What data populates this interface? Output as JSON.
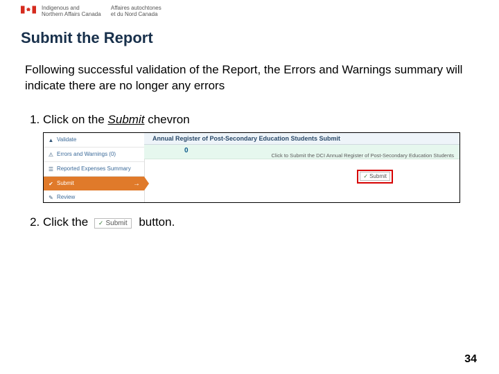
{
  "gov": {
    "dept_en_1": "Indigenous and",
    "dept_en_2": "Northern Affairs Canada",
    "dept_fr_1": "Affaires autochtones",
    "dept_fr_2": "et du Nord Canada"
  },
  "title": "Submit the Report",
  "intro": "Following successful validation of the Report, the Errors and Warnings summary will indicate there are no longer any errors",
  "step1_a": "Click on the ",
  "step1_b": "Submit",
  "step1_c": " chevron",
  "step2_a": "Click the",
  "step2_b": "button.",
  "shot": {
    "sb_validate": "Validate",
    "sb_errors": "Errors and Warnings (0)",
    "sb_expenses": "Reported Expenses Summary",
    "sb_submit": "Submit",
    "sb_review": "Review",
    "main_title": "Annual Register of Post-Secondary Education Students Submit",
    "zero": "0",
    "instr": "Click to Submit the DCI Annual Register of Post-Secondary Education Students",
    "btn": "Submit"
  },
  "inline_btn": "Submit",
  "page_number": "34"
}
